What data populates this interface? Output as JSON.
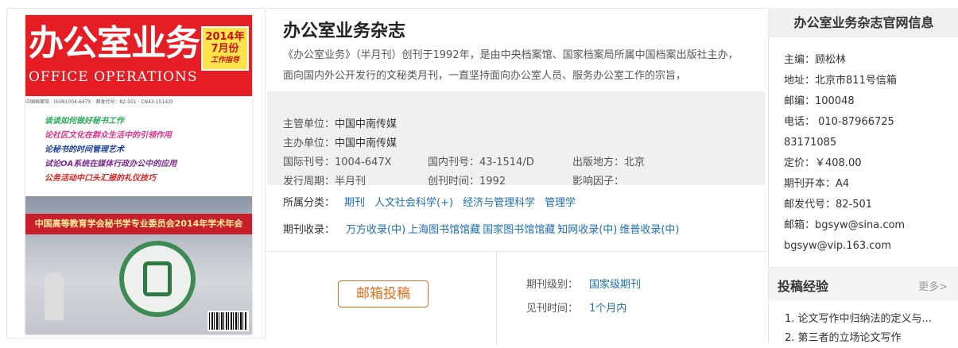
{
  "cover": {
    "title": "办公室业务",
    "subtitle_en": "OFFICE OPERATIONS",
    "badge_year": "2014年",
    "badge_month": "7月份",
    "badge_note": "工作指导",
    "meta_line": "中国档案馆 · ISSN1004-647X · 邮发代号：82-501 · CN43-1514/D",
    "lines": [
      {
        "text": "谈谈如何做好秘书工作",
        "color": "#2aa85a"
      },
      {
        "text": "论社区文化在群众生活中的引领作用",
        "color": "#e0318c"
      },
      {
        "text": "论秘书的时间管理艺术",
        "color": "#1e3f9b"
      },
      {
        "text": "试论OA系统在媒体行政办公中的应用",
        "color": "#7a2b8f"
      },
      {
        "text": "公务活动中口头汇报的礼仪技巧",
        "color": "#e02020"
      }
    ],
    "banner": "中国高等教育学会秘书学专业委员会2014年学术年会"
  },
  "magazine": {
    "title": "办公室业务杂志",
    "desc": "《办公室业务》（半月刊）创刊于1992年，是由中央档案馆、国家档案局所属中国档案出版社主办，面向国内外公开发行的文秘类月刊，一直坚持面向办公室人员、服务办公室工作的宗旨，",
    "supervisor_label": "主管单位：",
    "supervisor": "中国中南传媒",
    "sponsor_label": "主办单位：",
    "sponsor": "中国中南传媒",
    "issn_label": "国际刊号：",
    "issn": "1004-647X",
    "cn_label": "国内刊号：",
    "cn": "43-1514/D",
    "place_label": "出版地方：",
    "place": "北京",
    "cycle_label": "发行周期：",
    "cycle": "半月刊",
    "founded_label": "创刊时间：",
    "founded": "1992",
    "impact_label": "影响因子：",
    "impact": "",
    "category_label": "所属分类：",
    "categories": [
      "期刊",
      "人文社会科学(+)",
      "经济与管理科学",
      "管理学"
    ],
    "included_label": "期刊收录：",
    "included": [
      "万方收录(中)",
      "上海图书馆馆藏",
      "国家图书馆馆藏",
      "知网收录(中)",
      "维普收录(中)"
    ],
    "submit_button": "邮箱投稿",
    "level_label": "期刊级别：",
    "level": "国家级期刊",
    "time_label": "见刊时间：",
    "time": "1个月内"
  },
  "official": {
    "heading": "办公室业务杂志官网信息",
    "items": [
      "主编：顾松林",
      "地址：北京市811号信箱",
      "邮编：100048",
      "电话： 010-87966725",
      "83171085",
      "定价：￥408.00",
      "期刊开本：A4",
      "邮发代号：82-501",
      "邮箱：bgsyw@sina.com",
      "bgsyw@vip.163.com"
    ]
  },
  "experience": {
    "heading": "投稿经验",
    "more": "更多>",
    "items": [
      "1. 论文写作中归纳法的定义与...",
      "2. 第三者的立场论文写作"
    ]
  }
}
